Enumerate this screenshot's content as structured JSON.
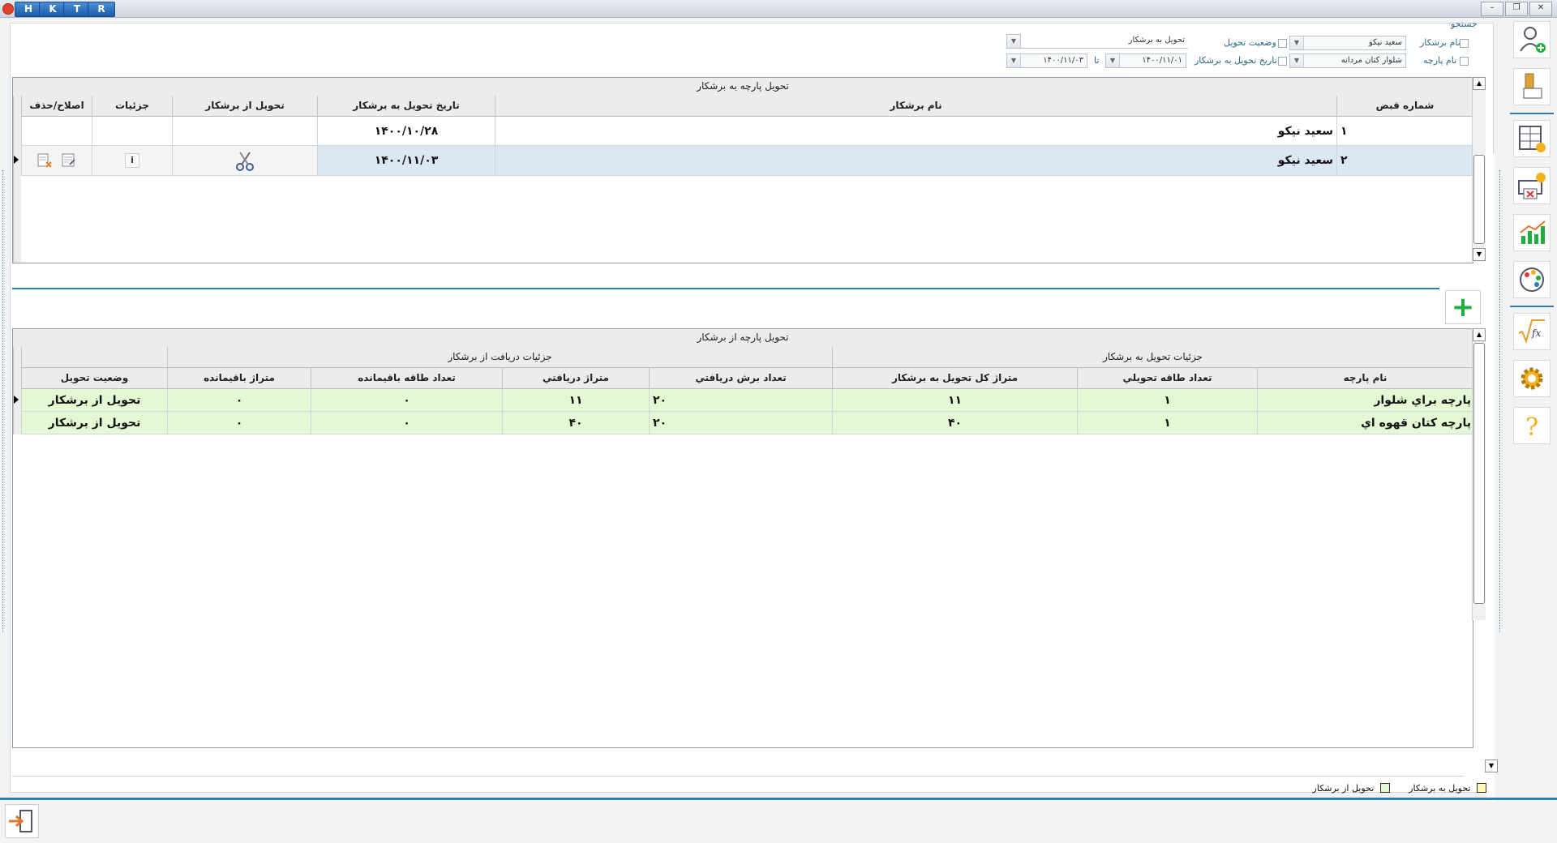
{
  "titlebar": {
    "tabs": [
      "H",
      "K",
      "T",
      "R"
    ],
    "controls": [
      "–",
      "❐",
      "✕"
    ]
  },
  "search": {
    "group_title": "جستجو",
    "field_tailor_name": {
      "label": "نام برشکار",
      "value": "سعید نیکو"
    },
    "field_fabric_name": {
      "label": "نام پارچه",
      "value": "شلوار کتان مردانه"
    },
    "field_delivery_status": {
      "label": "وضعیت تحویل",
      "value": "تحویل به برشکار"
    },
    "field_delivery_date": {
      "label": "تاریخ تحویل به برشکار",
      "from": "۱۴۰۰/۱۱/۰۱",
      "to_label": "تا",
      "to": "۱۴۰۰/۱۱/۰۳"
    }
  },
  "grid1": {
    "caption": "تحویل پارچه به برشکار",
    "columns": [
      "شماره قبض",
      "نام برشکار",
      "تاریخ تحویل به برشکار",
      "تحویل از برشکار",
      "جزئیات",
      "اصلاح/حذف"
    ],
    "rows": [
      {
        "receipt_no": "۱",
        "tailor": "سعید نیکو",
        "date": "۱۴۰۰/۱۰/۲۸"
      },
      {
        "receipt_no": "۲",
        "tailor": "سعید نیکو",
        "date": "۱۴۰۰/۱۱/۰۳"
      }
    ]
  },
  "add_button_symbol": "+",
  "grid2": {
    "caption": "تحویل پارچه از برشکار",
    "group_delivery": "جزئیات تحویل به برشکار",
    "group_receive": "جزئیات دریافت از برشکار",
    "columns": [
      "نام پارچه",
      "تعداد طاقه تحويلي",
      "متراژ کل تحویل به برشکار",
      "تعداد برش دريافتي",
      "متراژ دريافتي",
      "تعداد طاقه باقیمانده",
      "متراژ باقیمانده",
      "وضعیت تحویل"
    ],
    "rows": [
      {
        "fabric": "پارچه براي شلوار",
        "bolts": "۱",
        "meters_total": "۱۱",
        "cuts": "۲۰",
        "meters_recv": "۱۱",
        "bolts_left": "۰",
        "meters_left": "۰",
        "status": "تحویل از برشکار"
      },
      {
        "fabric": "پارچه کتان قهوه اي",
        "bolts": "۱",
        "meters_total": "۴۰",
        "cuts": "۲۰",
        "meters_recv": "۴۰",
        "bolts_left": "۰",
        "meters_left": "۰",
        "status": "تحویل از برشکار"
      }
    ]
  },
  "legend": {
    "delivered_to": "تحویل به برشکار",
    "delivered_from": "تحویل از برشکار"
  },
  "colors": {
    "accent": "#2e7fb1",
    "selected_row": "#dce7f4",
    "delivered_from_row": "#e4f8d4",
    "add_plus": "#1fae3c"
  },
  "icons": {
    "right_toolbar": [
      "add-user-icon",
      "tools-icon",
      "table-money-icon",
      "print-money-icon",
      "chart-icon",
      "palette-icon",
      "formula-icon",
      "gear-icon",
      "help-icon"
    ],
    "exit": "exit-icon"
  }
}
